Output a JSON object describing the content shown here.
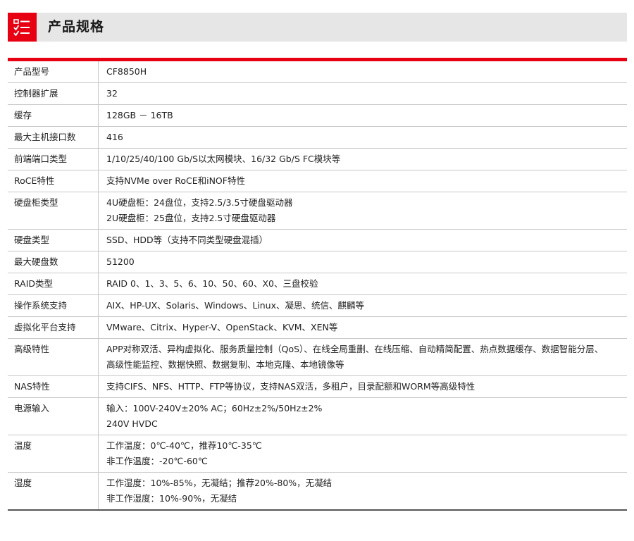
{
  "section_title": "产品规格",
  "colors": {
    "accent": "#e60012",
    "header_bg": "#e6e6e6",
    "border": "#c8c8c8"
  },
  "icon": "checklist-icon",
  "specs": [
    {
      "key": "产品型号",
      "lines": [
        "CF8850H"
      ]
    },
    {
      "key": "控制器扩展",
      "lines": [
        "32"
      ]
    },
    {
      "key": "缓存",
      "lines": [
        "128GB － 16TB"
      ]
    },
    {
      "key": "最大主机接口数",
      "lines": [
        "416"
      ]
    },
    {
      "key": "前端端口类型",
      "lines": [
        "1/10/25/40/100 Gb/S以太网模块、16/32 Gb/S FC模块等"
      ]
    },
    {
      "key": "RoCE特性",
      "lines": [
        "支持NVMe over RoCE和iNOF特性"
      ]
    },
    {
      "key": "硬盘柜类型",
      "lines": [
        "4U硬盘柜：24盘位，支持2.5/3.5寸硬盘驱动器",
        "2U硬盘柜：25盘位，支持2.5寸硬盘驱动器"
      ]
    },
    {
      "key": "硬盘类型",
      "lines": [
        "SSD、HDD等（支持不同类型硬盘混插）"
      ]
    },
    {
      "key": "最大硬盘数",
      "lines": [
        "51200"
      ]
    },
    {
      "key": "RAID类型",
      "lines": [
        "RAID 0、1、3、5、6、10、50、60、X0、三盘校验"
      ]
    },
    {
      "key": "操作系统支持",
      "lines": [
        "AIX、HP-UX、Solaris、Windows、Linux、凝思、统信、麒麟等"
      ]
    },
    {
      "key": "虚拟化平台支持",
      "lines": [
        "VMware、Citrix、Hyper-V、OpenStack、KVM、XEN等"
      ]
    },
    {
      "key": "高级特性",
      "lines": [
        "APP对称双活、异构虚拟化、服务质量控制（QoS）、在线全局重删、在线压缩、自动精简配置、热点数据缓存、数据智能分层、",
        "高级性能监控、数据快照、数据复制、本地克隆、本地镜像等"
      ]
    },
    {
      "key": "NAS特性",
      "lines": [
        "支持CIFS、NFS、HTTP、FTP等协议，支持NAS双活，多租户，目录配额和WORM等高级特性"
      ]
    },
    {
      "key": "电源输入",
      "lines": [
        "输入：100V-240V±20% AC；60Hz±2%/50Hz±2%",
        "240V HVDC"
      ]
    },
    {
      "key": "温度",
      "lines": [
        "工作温度：0℃-40℃，推荐10℃-35℃",
        "非工作温度：-20℃-60℃"
      ]
    },
    {
      "key": "湿度",
      "lines": [
        "工作湿度：10%-85%，无凝结；推荐20%-80%，无凝结",
        "非工作湿度：10%-90%，无凝结"
      ]
    }
  ]
}
